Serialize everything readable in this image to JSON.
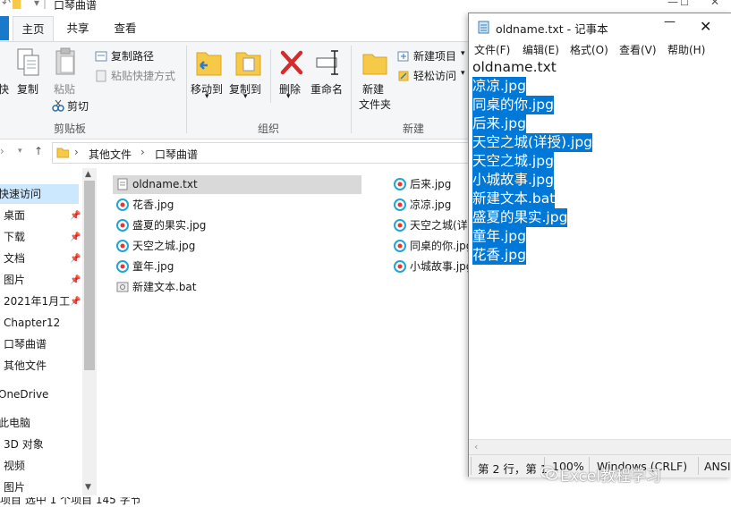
{
  "explorer": {
    "title": "口琴曲谱",
    "tabs": {
      "file": "",
      "home": "主页",
      "share": "共享",
      "view": "查看"
    },
    "ribbon": {
      "pin_label": "快",
      "copy": "复制",
      "paste": "粘贴",
      "copy_path": "复制路径",
      "paste_shortcut": "粘贴快捷方式",
      "cut": "剪切",
      "clipboard_group": "剪贴板",
      "move_to": "移动到",
      "copy_to": "复制到",
      "delete": "删除",
      "rename": "重命名",
      "organize_group": "组织",
      "new_folder_line1": "新建",
      "new_folder_line2": "文件夹",
      "new_item": "新建项目",
      "easy_access": "轻松访问",
      "new_group": "新建"
    },
    "address": {
      "crumbs": [
        "其他文件",
        "口琴曲谱"
      ]
    },
    "nav": [
      {
        "label": "快速访问",
        "selected": true,
        "pinned": false
      },
      {
        "label": "桌面",
        "pinned": true
      },
      {
        "label": "下载",
        "pinned": true
      },
      {
        "label": "文档",
        "pinned": true
      },
      {
        "label": "图片",
        "pinned": true
      },
      {
        "label": "2021年1月工",
        "pinned": true
      },
      {
        "label": "Chapter12",
        "pinned": false
      },
      {
        "label": "口琴曲谱",
        "pinned": false
      },
      {
        "label": "其他文件",
        "pinned": false
      },
      {
        "label": "OneDrive",
        "pinned": false
      },
      {
        "label": "此电脑",
        "pinned": false
      },
      {
        "label": "3D 对象",
        "pinned": false
      },
      {
        "label": "视频",
        "pinned": false
      },
      {
        "label": "图片",
        "pinned": false
      }
    ],
    "files_col1": [
      {
        "name": "oldname.txt",
        "type": "txt",
        "selected": true
      },
      {
        "name": "花香.jpg",
        "type": "jpg"
      },
      {
        "name": "盛夏的果实.jpg",
        "type": "jpg"
      },
      {
        "name": "天空之城.jpg",
        "type": "jpg"
      },
      {
        "name": "童年.jpg",
        "type": "jpg"
      },
      {
        "name": "新建文本.bat",
        "type": "bat"
      }
    ],
    "files_col2": [
      {
        "name": "后来.jpg",
        "type": "jpg"
      },
      {
        "name": "凉凉.jpg",
        "type": "jpg"
      },
      {
        "name": "天空之城(详",
        "type": "jpg"
      },
      {
        "name": "同桌的你.jpg",
        "type": "jpg"
      },
      {
        "name": "小城故事.jpg",
        "type": "jpg"
      }
    ],
    "status": "项目    选中 1 个项目  145 字节"
  },
  "notepad": {
    "title": "oldname.txt - 记事本",
    "menus": [
      "文件(F)",
      "编辑(E)",
      "格式(O)",
      "查看(V)",
      "帮助(H)"
    ],
    "lines": [
      {
        "text": "oldname.txt",
        "highlight": false
      },
      {
        "text": "凉凉.jpg",
        "highlight": true
      },
      {
        "text": "同桌的你.jpg",
        "highlight": true
      },
      {
        "text": "后来.jpg",
        "highlight": true
      },
      {
        "text": "天空之城(详授).jpg",
        "highlight": true
      },
      {
        "text": "天空之城.jpg",
        "highlight": true
      },
      {
        "text": "小城故事.jpg",
        "highlight": true
      },
      {
        "text": "新建文本.bat",
        "highlight": true
      },
      {
        "text": "盛夏的果实.jpg",
        "highlight": true
      },
      {
        "text": "童年.jpg",
        "highlight": true
      },
      {
        "text": "花香.jpg",
        "highlight": true
      }
    ],
    "status": {
      "position": "第 2 行，第 1",
      "zoom": "100%",
      "eol": "Windows (CRLF)",
      "encoding": "ANSI"
    }
  },
  "watermark": "Excel教程学习",
  "colors": {
    "selection": "#0078d7",
    "nav_selected": "#cce8ff",
    "ribbon_bg": "#f5f6f7",
    "file_tab": "#1979ca",
    "delete_red": "#d42b2b",
    "folder_yellow": "#f7c948"
  }
}
